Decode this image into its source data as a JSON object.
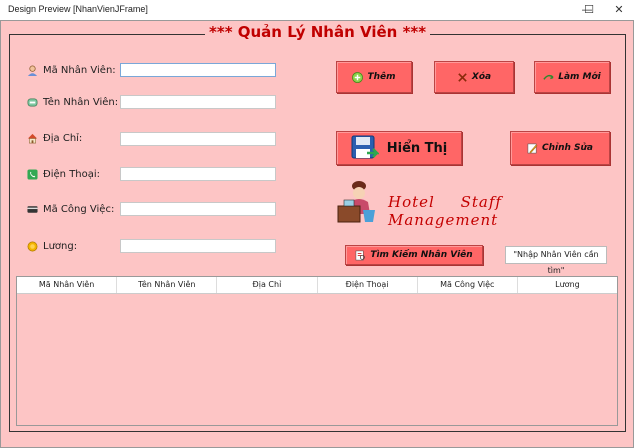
{
  "window": {
    "title": "Design Preview [NhanVienJFrame]",
    "minimize": "—",
    "maximize": "☐",
    "close": "✕"
  },
  "header": {
    "title": "*** Quản Lý Nhân Viên ***"
  },
  "form": {
    "fields": [
      {
        "label": "Mã Nhân Viên:",
        "value": "",
        "icon": "person-icon"
      },
      {
        "label": "Tên Nhân Viên:",
        "value": "",
        "icon": "id-card-icon"
      },
      {
        "label": "Địa Chỉ:",
        "value": "",
        "icon": "home-icon"
      },
      {
        "label": "Điện Thoại:",
        "value": "",
        "icon": "phone-icon"
      },
      {
        "label": "Mã Công Việc:",
        "value": "",
        "icon": "card-icon"
      },
      {
        "label": "Lương:",
        "value": "",
        "icon": "coin-icon"
      }
    ]
  },
  "buttons": {
    "add": "Thêm",
    "delete": "Xóa",
    "refresh": "Làm Mới",
    "show": "Hiển Thị",
    "edit": "Chỉnh Sửa",
    "search": "Tìm Kiếm Nhân Viên"
  },
  "logo_text": "Hotel Staff Management",
  "search": {
    "placeholder": "\"Nhập Nhân Viên cần tìm\""
  },
  "table": {
    "columns": [
      "Mã Nhân Viên",
      "Tên Nhân Viên",
      "Địa Chỉ",
      "Điện Thoại",
      "Mã Công Việc",
      "Lương"
    ],
    "rows": []
  },
  "colors": {
    "background": "#fdc5c5",
    "button": "#ff6666",
    "title": "#c00000"
  }
}
